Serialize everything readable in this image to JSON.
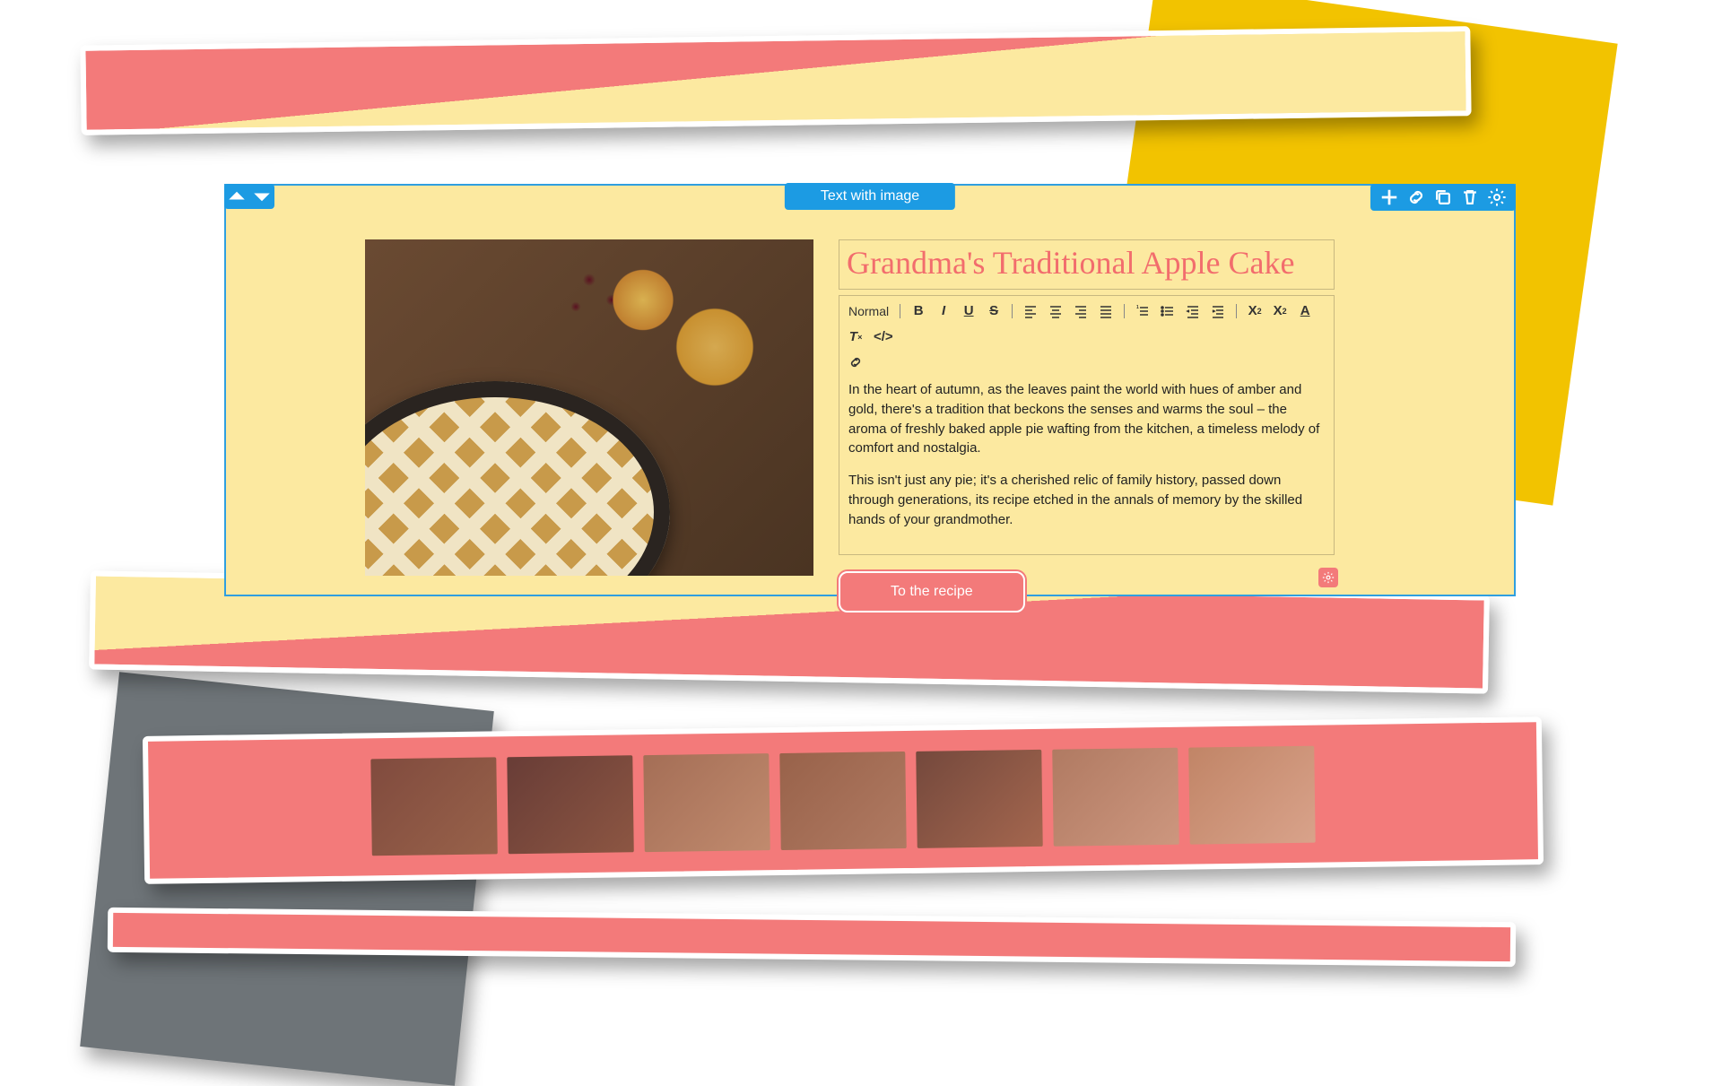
{
  "block_label": "Text with image",
  "title": "Grandma's Traditional Apple Cake",
  "format_label": "Normal",
  "paragraphs": [
    "In the heart of autumn, as the leaves paint the world with hues of amber and gold, there's a tradition that beckons the senses and warms the soul – the aroma of freshly baked apple pie wafting from the kitchen, a timeless melody of comfort and nostalgia.",
    "This isn't just any pie; it's a cherished relic of family history, passed down through generations, its recipe etched in the annals of memory by the skilled hands of your grandmother."
  ],
  "cta_label": "To the recipe",
  "toolbar_icons": [
    "bold",
    "italic",
    "underline",
    "strike",
    "align-left",
    "align-center",
    "align-right",
    "align-justify",
    "list-ordered",
    "list-bullet",
    "indent-decrease",
    "indent-increase",
    "subscript",
    "superscript",
    "text-color",
    "clear-format",
    "code",
    "link"
  ],
  "colors": {
    "accent_blue": "#1c9be3",
    "panel_yellow": "#fce9a0",
    "coral": "#f37a7a",
    "title_coral": "#f26d6d"
  }
}
